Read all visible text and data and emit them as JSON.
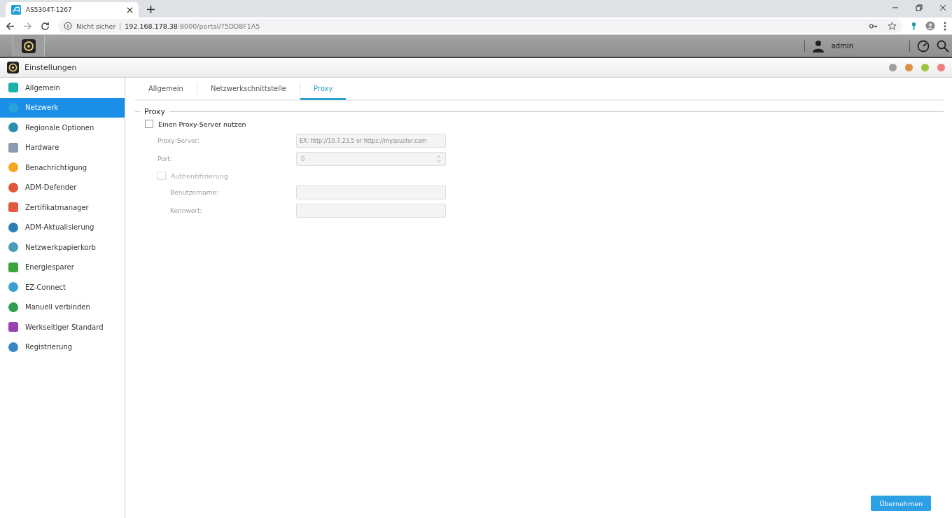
{
  "browser": {
    "tab_title": "AS5304T-1267",
    "security": "Nicht sicher",
    "url_host": "192.168.178.38",
    "url_rest": ":8000/portal/?5DD8F1A5"
  },
  "topbar": {
    "user": "admin"
  },
  "window": {
    "title": "Einstellungen"
  },
  "sidebar": {
    "items": [
      {
        "label": "Allgemein",
        "selected": false
      },
      {
        "label": "Netzwerk",
        "selected": true
      },
      {
        "label": "Regionale Optionen",
        "selected": false
      },
      {
        "label": "Hardware",
        "selected": false
      },
      {
        "label": "Benachrichtigung",
        "selected": false
      },
      {
        "label": "ADM-Defender",
        "selected": false
      },
      {
        "label": "Zertifikatmanager",
        "selected": false
      },
      {
        "label": "ADM-Aktualisierung",
        "selected": false
      },
      {
        "label": "Netzwerkpapierkorb",
        "selected": false
      },
      {
        "label": "Energiesparer",
        "selected": false
      },
      {
        "label": "EZ-Connect",
        "selected": false
      },
      {
        "label": "Manuell verbinden",
        "selected": false
      },
      {
        "label": "Werkseitiger Standard",
        "selected": false
      },
      {
        "label": "Registrierung",
        "selected": false
      }
    ]
  },
  "tabs": [
    {
      "label": "Allgemein",
      "selected": false
    },
    {
      "label": "Netzwerkschnittstelle",
      "selected": false
    },
    {
      "label": "Proxy",
      "selected": true
    }
  ],
  "section": {
    "title": "Proxy"
  },
  "use_proxy": {
    "label": "Einen Proxy-Server nutzen",
    "checked": false
  },
  "fields": [
    {
      "kind": "text",
      "label": "Proxy-Server:",
      "placeholder": "EX: http://10.7.23.5 or https://myasustor.com",
      "disabled": true
    },
    {
      "kind": "number",
      "label": "Port:",
      "value": "0",
      "disabled": true
    }
  ],
  "auth": {
    "label": "Authentifizierung",
    "checked": false,
    "disabled": true
  },
  "auth_fields": [
    {
      "label": "Benutzername:",
      "disabled": true
    },
    {
      "label": "Kennwort:",
      "disabled": true
    }
  ],
  "apply_button": "Übernehmen"
}
